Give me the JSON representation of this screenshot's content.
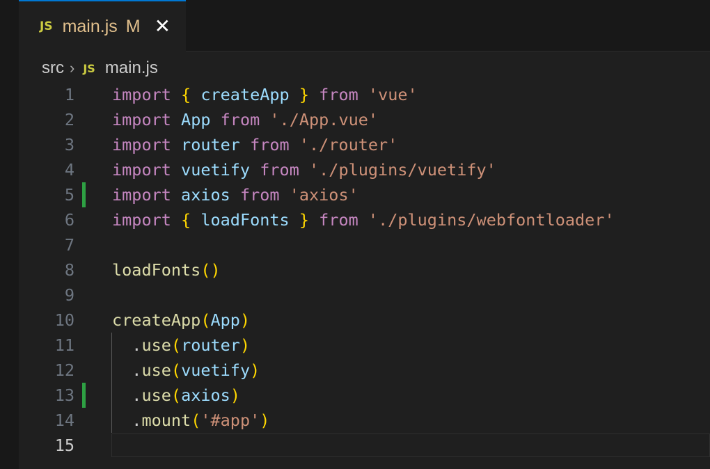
{
  "tab": {
    "badge": "JS",
    "title": "main.js",
    "modified": "M",
    "close": "✕"
  },
  "breadcrumb": {
    "folder": "src",
    "separator": "›",
    "badge": "JS",
    "file": "main.js"
  },
  "colors": {
    "keyword": "#c586c0",
    "identifier": "#9cdcfe",
    "string": "#ce9178",
    "function": "#dcdcaa",
    "bracket": "#ffd700",
    "git_added": "#2ea043",
    "active_tab_border": "#0078d4"
  },
  "editor": {
    "active_line": 15,
    "lines": [
      {
        "n": "1",
        "git_added": false,
        "tokens": [
          [
            "kw",
            "import"
          ],
          [
            "plain",
            " "
          ],
          [
            "br1",
            "{"
          ],
          [
            "plain",
            " "
          ],
          [
            "id",
            "createApp"
          ],
          [
            "plain",
            " "
          ],
          [
            "br1",
            "}"
          ],
          [
            "plain",
            " "
          ],
          [
            "kw",
            "from"
          ],
          [
            "plain",
            " "
          ],
          [
            "str",
            "'vue'"
          ]
        ]
      },
      {
        "n": "2",
        "git_added": false,
        "tokens": [
          [
            "kw",
            "import"
          ],
          [
            "plain",
            " "
          ],
          [
            "id",
            "App"
          ],
          [
            "plain",
            " "
          ],
          [
            "kw",
            "from"
          ],
          [
            "plain",
            " "
          ],
          [
            "str",
            "'./App.vue'"
          ]
        ]
      },
      {
        "n": "3",
        "git_added": false,
        "tokens": [
          [
            "kw",
            "import"
          ],
          [
            "plain",
            " "
          ],
          [
            "id",
            "router"
          ],
          [
            "plain",
            " "
          ],
          [
            "kw",
            "from"
          ],
          [
            "plain",
            " "
          ],
          [
            "str",
            "'./router'"
          ]
        ]
      },
      {
        "n": "4",
        "git_added": false,
        "tokens": [
          [
            "kw",
            "import"
          ],
          [
            "plain",
            " "
          ],
          [
            "id",
            "vuetify"
          ],
          [
            "plain",
            " "
          ],
          [
            "kw",
            "from"
          ],
          [
            "plain",
            " "
          ],
          [
            "str",
            "'./plugins/vuetify'"
          ]
        ]
      },
      {
        "n": "5",
        "git_added": true,
        "tokens": [
          [
            "kw",
            "import"
          ],
          [
            "plain",
            " "
          ],
          [
            "id",
            "axios"
          ],
          [
            "plain",
            " "
          ],
          [
            "kw",
            "from"
          ],
          [
            "plain",
            " "
          ],
          [
            "str",
            "'axios'"
          ]
        ]
      },
      {
        "n": "6",
        "git_added": false,
        "tokens": [
          [
            "kw",
            "import"
          ],
          [
            "plain",
            " "
          ],
          [
            "br1",
            "{"
          ],
          [
            "plain",
            " "
          ],
          [
            "id",
            "loadFonts"
          ],
          [
            "plain",
            " "
          ],
          [
            "br1",
            "}"
          ],
          [
            "plain",
            " "
          ],
          [
            "kw",
            "from"
          ],
          [
            "plain",
            " "
          ],
          [
            "str",
            "'./plugins/webfontloader'"
          ]
        ]
      },
      {
        "n": "7",
        "git_added": false,
        "tokens": []
      },
      {
        "n": "8",
        "git_added": false,
        "tokens": [
          [
            "fn",
            "loadFonts"
          ],
          [
            "br1",
            "()"
          ]
        ]
      },
      {
        "n": "9",
        "git_added": false,
        "tokens": []
      },
      {
        "n": "10",
        "git_added": false,
        "tokens": [
          [
            "fn",
            "createApp"
          ],
          [
            "br1",
            "("
          ],
          [
            "id",
            "App"
          ],
          [
            "br1",
            ")"
          ]
        ]
      },
      {
        "n": "11",
        "git_added": false,
        "tokens": [
          [
            "plain",
            "  ."
          ],
          [
            "fn",
            "use"
          ],
          [
            "br1",
            "("
          ],
          [
            "id",
            "router"
          ],
          [
            "br1",
            ")"
          ]
        ]
      },
      {
        "n": "12",
        "git_added": false,
        "tokens": [
          [
            "plain",
            "  ."
          ],
          [
            "fn",
            "use"
          ],
          [
            "br1",
            "("
          ],
          [
            "id",
            "vuetify"
          ],
          [
            "br1",
            ")"
          ]
        ]
      },
      {
        "n": "13",
        "git_added": true,
        "tokens": [
          [
            "plain",
            "  ."
          ],
          [
            "fn",
            "use"
          ],
          [
            "br1",
            "("
          ],
          [
            "id",
            "axios"
          ],
          [
            "br1",
            ")"
          ]
        ]
      },
      {
        "n": "14",
        "git_added": false,
        "tokens": [
          [
            "plain",
            "  ."
          ],
          [
            "fn",
            "mount"
          ],
          [
            "br1",
            "("
          ],
          [
            "str",
            "'#app'"
          ],
          [
            "br1",
            ")"
          ]
        ]
      },
      {
        "n": "15",
        "git_added": false,
        "tokens": []
      }
    ]
  }
}
